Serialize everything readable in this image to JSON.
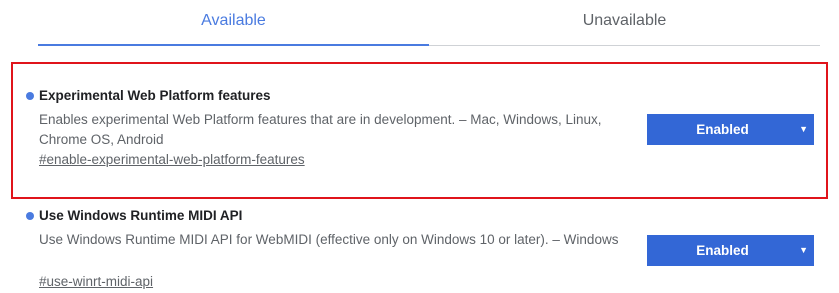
{
  "tabs": [
    {
      "label": "Available",
      "selected": true
    },
    {
      "label": "Unavailable",
      "selected": false
    }
  ],
  "colors": {
    "accent": "#4a7be0",
    "select_bg": "#3367d6",
    "highlight_border": "#e0141b"
  },
  "experiments": [
    {
      "title": "Experimental Web Platform features",
      "description": "Enables experimental Web Platform features that are in development. – Mac, Windows, Linux, Chrome OS, Android",
      "link": "#enable-experimental-web-platform-features",
      "state": "Enabled",
      "highlighted": true
    },
    {
      "title": "Use Windows Runtime MIDI API",
      "description": "Use Windows Runtime MIDI API for WebMIDI (effective only on Windows 10 or later). – Windows",
      "link": "#use-winrt-midi-api",
      "state": "Enabled",
      "highlighted": false
    }
  ],
  "icons": {
    "dropdown_arrow": "▼",
    "bullet": "blue-dot"
  }
}
